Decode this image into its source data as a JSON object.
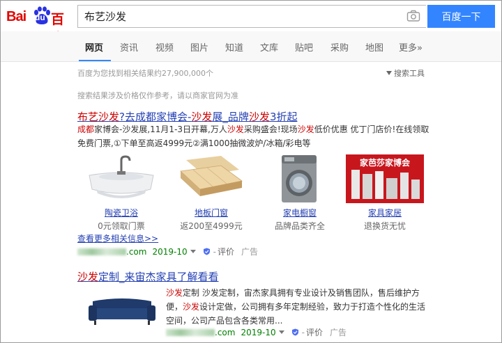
{
  "logo": {
    "latin": "Bai",
    "du": "du",
    "cn": "百度"
  },
  "search": {
    "query": "布艺沙发",
    "button": "百度一下"
  },
  "nav": [
    {
      "label": "网页",
      "active": true
    },
    {
      "label": "资讯"
    },
    {
      "label": "视频"
    },
    {
      "label": "图片"
    },
    {
      "label": "知道"
    },
    {
      "label": "文库"
    },
    {
      "label": "贴吧"
    },
    {
      "label": "采购"
    },
    {
      "label": "地图"
    },
    {
      "label": "更多»"
    }
  ],
  "stats": "百度为您找到相关结果约27,900,000个",
  "tools": "搜索工具",
  "notice": "搜索结果涉及价格仅作参考，请以商家官网为准",
  "result1": {
    "title_parts": [
      "布艺",
      "沙发",
      "?去成都家博会-",
      "沙发",
      "展_品牌",
      "沙发",
      "3折起"
    ],
    "desc_line1_parts": [
      "成都",
      "家博会-沙发展,11月1-3日开幕,万人",
      "沙发",
      "采购盛会!现场",
      "沙发",
      "低价优惠 优丁门店价!在线领取"
    ],
    "desc_line2": "免费门票,①下单至高返4999元②满1000抽微波炉/冰箱/彩电等",
    "thumbs": [
      {
        "link": "陶瓷卫浴",
        "sub": "0元领取门票"
      },
      {
        "link": "地板门窗",
        "sub": "返200至4999元"
      },
      {
        "link": "家电橱窗",
        "sub": "品牌品类齐全"
      },
      {
        "link": "家具家居",
        "sub": "退换货无忧"
      }
    ],
    "banner_text": "家芭莎家博会",
    "more": "查看更多相关信息>>",
    "url_suffix": ".com",
    "date": "2019-10",
    "review": "评价",
    "ad": "广告"
  },
  "result2": {
    "title_parts": [
      "沙发",
      "定制_来宙杰家具了解看看"
    ],
    "desc_line1_parts": [
      "沙发",
      "定制   沙发定制，宙杰家具拥有专业设计及销售团队，售后维护方"
    ],
    "desc_line2_parts": [
      "便，",
      "沙发",
      "设计定做，公司拥有多年定制经验，致力于打造个性化的生活"
    ],
    "desc_line3": "空间，公司产品包含各类常用...",
    "url_suffix": ".com",
    "date": "2019-10",
    "review": "评价",
    "ad": "广告"
  },
  "colors": {
    "brand_red": "#e10601",
    "brand_blue": "#3385ff",
    "link": "#2440b3",
    "url_green": "#008000",
    "highlight": "#cc0000"
  }
}
